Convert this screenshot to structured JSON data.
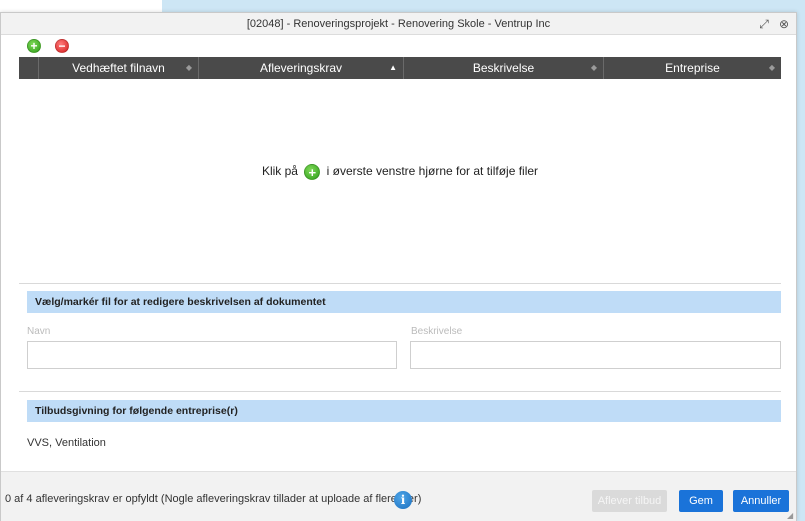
{
  "window": {
    "title": "[02048] - Renoveringsprojekt - Renovering Skole - Ventrup Inc"
  },
  "toolbar": {
    "add_icon": "plus-circle-green",
    "remove_icon": "minus-circle-red"
  },
  "grid": {
    "columns": [
      {
        "label": ""
      },
      {
        "label": "Vedhæftet filnavn"
      },
      {
        "label": "Afleveringskrav"
      },
      {
        "label": "Beskrivelse"
      },
      {
        "label": "Entreprise"
      }
    ],
    "empty_message_before": "Klik på",
    "empty_message_after": "i øverste venstre hjørne for at tilføje filer"
  },
  "edit_section": {
    "heading": "Vælg/markér fil for at redigere beskrivelsen af dokumentet",
    "name_label": "Navn",
    "name_value": "",
    "description_label": "Beskrivelse",
    "description_value": ""
  },
  "tender_section": {
    "heading": "Tilbudsgivning for følgende entreprise(r)",
    "value": "VVS, Ventilation"
  },
  "footer": {
    "status": "0 af 4 afleveringskrav er opfyldt (Nogle afleveringskrav tillader at uploade af flere filer)",
    "submit_label": "Aflever tilbud",
    "save_label": "Gem",
    "cancel_label": "Annuller"
  },
  "colors": {
    "accent": "#1a73d9",
    "section_header": "#bfdcf7",
    "grid_header": "#4a4a4a"
  }
}
